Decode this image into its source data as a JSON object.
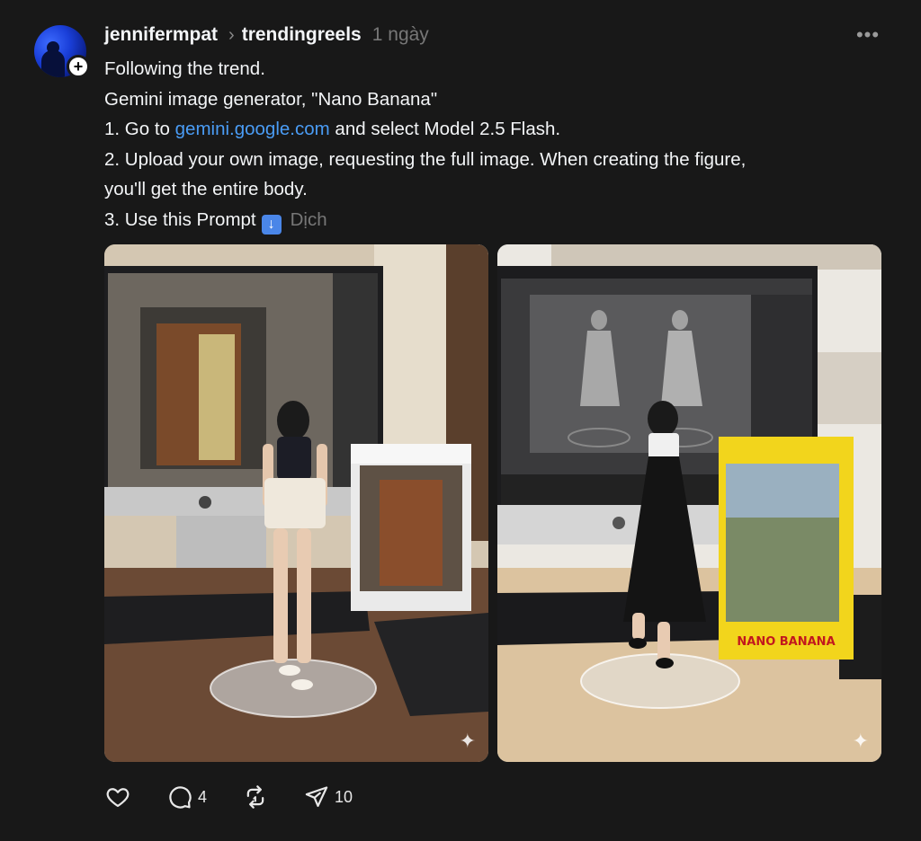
{
  "post": {
    "username": "jennifermpat",
    "community": "trendingreels",
    "time": "1 ngày",
    "more_icon": "more-horizontal-icon",
    "follow_icon": "plus-icon",
    "lines": {
      "l1": "Following the trend.",
      "l2": "Gemini image generator, \"Nano Banana\"",
      "l3_pre": "1. Go to ",
      "l3_link": "gemini.google.com",
      "l3_post": " and select Model 2.5 Flash.",
      "l4": "2. Upload your own image, requesting the full image. When creating the figure,",
      "l5": "you'll get the entire body.",
      "l6": "3. Use this Prompt",
      "translate": "Dịch"
    },
    "images": [
      {
        "alt": "Figure of a woman in black top and white shorts on a clear base in front of an iMac with 3D software and a boxed figure"
      },
      {
        "alt": "Figure of a woman in black dress with sunglasses on a clear base in front of an iMac with 3D software and a Nano Banana box"
      }
    ],
    "box_label": "NANO BANANA",
    "actions": {
      "like_icon": "heart-icon",
      "comment_icon": "comment-icon",
      "comment_count": "4",
      "repost_icon": "repost-icon",
      "share_icon": "send-icon",
      "share_count": "10"
    }
  }
}
